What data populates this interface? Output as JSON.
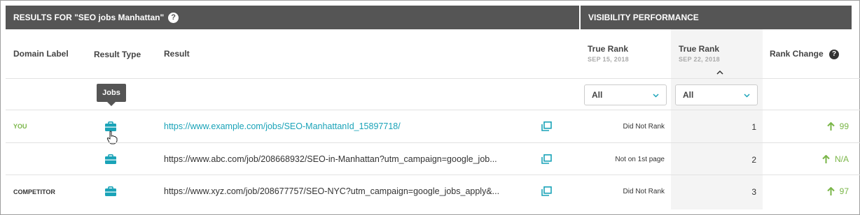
{
  "header": {
    "results_title": "RESULTS FOR \"SEO jobs Manhattan\"",
    "help_glyph": "?",
    "visibility_title": "VISIBILITY PERFORMANCE"
  },
  "columns": {
    "domain_label": "Domain Label",
    "result_type": "Result Type",
    "result": "Result",
    "true_rank_1": "True Rank",
    "true_rank_1_date": "SEP 15, 2018",
    "true_rank_2": "True Rank",
    "true_rank_2_date": "SEP 22, 2018",
    "rank_change": "Rank Change",
    "help_glyph": "?"
  },
  "filters": {
    "rank1_value": "All",
    "rank2_value": "All"
  },
  "tooltip": {
    "text": "Jobs"
  },
  "rows": [
    {
      "label": "YOU",
      "label_color": "#7ab648",
      "type_icon": "briefcase-icon",
      "url": "https://www.example.com/jobs/SEO-ManhattanId_15897718/",
      "old_rank": "Did Not Rank",
      "new_rank": "1",
      "change": "99"
    },
    {
      "label": "",
      "label_color": "#333333",
      "type_icon": "briefcase-icon",
      "url": "https://www.abc.com/job/208668932/SEO-in-Manhattan?utm_campaign=google_job...",
      "old_rank": "Not on 1st page",
      "new_rank": "2",
      "change": "N/A"
    },
    {
      "label": "COMPETITOR",
      "label_color": "#333333",
      "type_icon": "briefcase-icon",
      "url": "https://www.xyz.com/job/208677757/SEO-NYC?utm_campaign=google_jobs_apply&...",
      "old_rank": "Did Not Rank",
      "new_rank": "3",
      "change": "97"
    }
  ],
  "colors": {
    "header_bg": "#555555",
    "accent_teal": "#1aa3b8",
    "positive_green": "#7ab648"
  }
}
